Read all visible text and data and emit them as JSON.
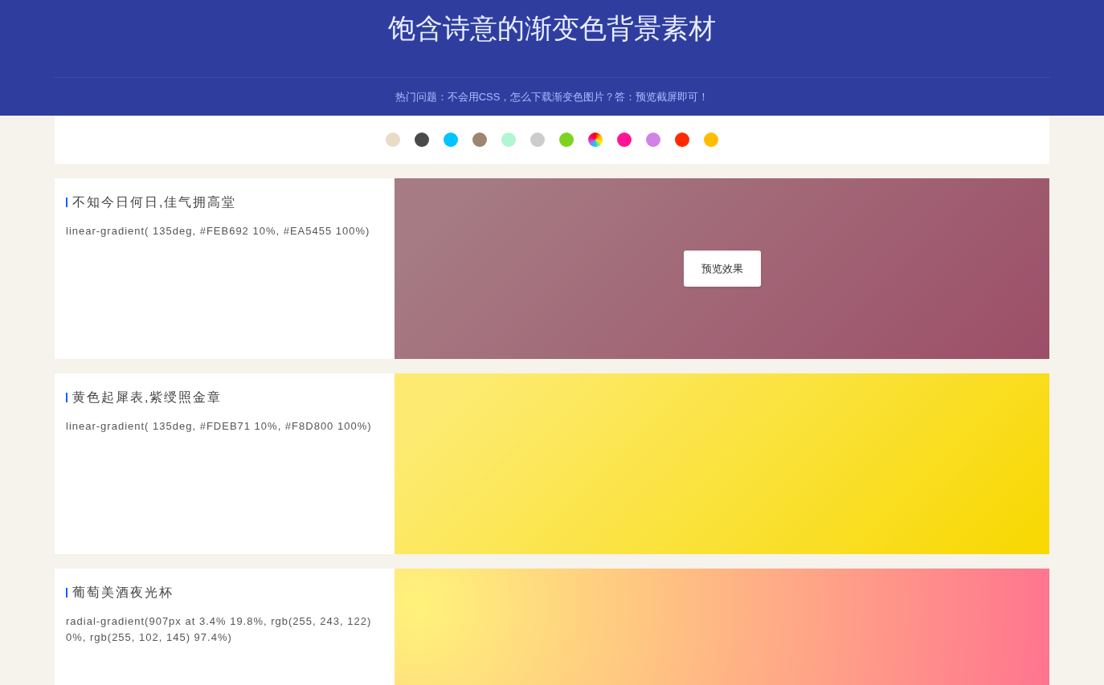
{
  "header": {
    "title": "饱含诗意的渐变色背景素材",
    "notice": "热门问题：不会用CSS，怎么下载渐变色图片？答：预览截屏即可！"
  },
  "swatches": [
    {
      "kind": "solid",
      "color": "#e8dcc6"
    },
    {
      "kind": "solid",
      "color": "#4a4a4a"
    },
    {
      "kind": "solid",
      "color": "#00c4ff"
    },
    {
      "kind": "solid",
      "color": "#9c8670"
    },
    {
      "kind": "solid",
      "color": "#b1f5d2"
    },
    {
      "kind": "solid",
      "color": "#cccccc"
    },
    {
      "kind": "solid",
      "color": "#7ed321"
    },
    {
      "kind": "rainbow"
    },
    {
      "kind": "solid",
      "color": "#ff1493"
    },
    {
      "kind": "solid",
      "color": "#d182e8"
    },
    {
      "kind": "solid",
      "color": "#ff2a00"
    },
    {
      "kind": "solid",
      "color": "#ffbd00"
    }
  ],
  "cards": [
    {
      "title": "不知今日何日,佳气拥高堂",
      "code": "linear-gradient( 135deg, #FEB692 10%, #EA5455 100%)",
      "hovered": true,
      "button": "预览效果"
    },
    {
      "title": "黄色起犀表,紫绶照金章",
      "code": "linear-gradient( 135deg, #FDEB71 10%, #F8D800 100%)",
      "hovered": false
    },
    {
      "title": "葡萄美酒夜光杯",
      "code": "radial-gradient(907px at 3.4% 19.8%, rgb(255, 243, 122) 0%, rgb(255, 102, 145) 97.4%)",
      "hovered": false
    }
  ]
}
